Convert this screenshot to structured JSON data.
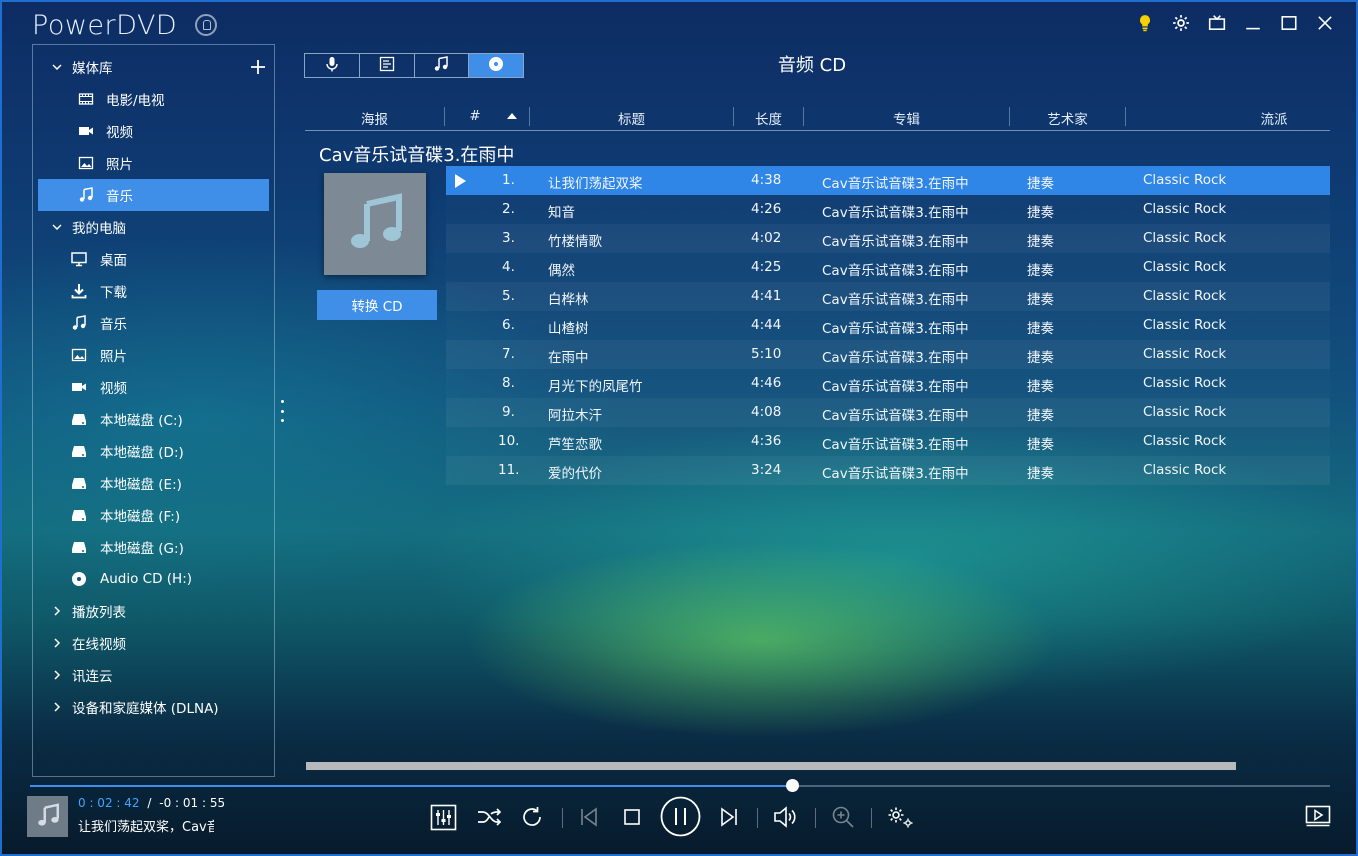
{
  "app": {
    "title": "PowerDVD"
  },
  "sidebar": {
    "media_library": {
      "label": "媒体库",
      "items": [
        {
          "label": "电影/电视",
          "icon": "film-icon"
        },
        {
          "label": "视频",
          "icon": "video-camera-icon"
        },
        {
          "label": "照片",
          "icon": "photo-icon"
        },
        {
          "label": "音乐",
          "icon": "music-note-icon",
          "active": true
        }
      ]
    },
    "my_computer": {
      "label": "我的电脑",
      "items": [
        {
          "label": "桌面",
          "icon": "monitor-icon"
        },
        {
          "label": "下载",
          "icon": "download-icon"
        },
        {
          "label": "音乐",
          "icon": "music-note-icon"
        },
        {
          "label": "照片",
          "icon": "photo-icon"
        },
        {
          "label": "视频",
          "icon": "video-camera-icon"
        },
        {
          "label": "本地磁盘 (C:)",
          "icon": "drive-icon"
        },
        {
          "label": "本地磁盘 (D:)",
          "icon": "drive-icon"
        },
        {
          "label": "本地磁盘 (E:)",
          "icon": "drive-icon"
        },
        {
          "label": "本地磁盘 (F:)",
          "icon": "drive-icon"
        },
        {
          "label": "本地磁盘 (G:)",
          "icon": "drive-icon"
        },
        {
          "label": "Audio CD (H:)",
          "icon": "disc-icon"
        }
      ]
    },
    "collapsed_sections": [
      {
        "label": "播放列表"
      },
      {
        "label": "在线视频"
      },
      {
        "label": "讯连云"
      },
      {
        "label": "设备和家庭媒体 (DLNA)"
      }
    ]
  },
  "tabs": [
    {
      "icon": "microphone-icon"
    },
    {
      "icon": "lyrics-sheet-icon"
    },
    {
      "icon": "music-note-icon"
    },
    {
      "icon": "cd-disc-icon",
      "active": true
    }
  ],
  "page_title": "音频 CD",
  "table": {
    "columns": {
      "poster": "海报",
      "number": "#",
      "title": "标题",
      "length": "长度",
      "album": "专辑",
      "artist": "艺术家",
      "genre": "流派"
    },
    "sort_column": "number",
    "sort_direction": "ascending"
  },
  "album": {
    "title": "Cav音乐试音碟3.在雨中",
    "convert_button": "转换 CD"
  },
  "tracks": [
    {
      "num": "1.",
      "title": "让我们荡起双桨",
      "length": "4:38",
      "album": "Cav音乐试音碟3.在雨中",
      "artist": "捷奏",
      "genre": "Classic Rock",
      "playing": true
    },
    {
      "num": "2.",
      "title": "知音",
      "length": "4:26",
      "album": "Cav音乐试音碟3.在雨中",
      "artist": "捷奏",
      "genre": "Classic Rock"
    },
    {
      "num": "3.",
      "title": "竹楼情歌",
      "length": "4:02",
      "album": "Cav音乐试音碟3.在雨中",
      "artist": "捷奏",
      "genre": "Classic Rock"
    },
    {
      "num": "4.",
      "title": "偶然",
      "length": "4:25",
      "album": "Cav音乐试音碟3.在雨中",
      "artist": "捷奏",
      "genre": "Classic Rock"
    },
    {
      "num": "5.",
      "title": "白桦林",
      "length": "4:41",
      "album": "Cav音乐试音碟3.在雨中",
      "artist": "捷奏",
      "genre": "Classic Rock"
    },
    {
      "num": "6.",
      "title": "山楂树",
      "length": "4:44",
      "album": "Cav音乐试音碟3.在雨中",
      "artist": "捷奏",
      "genre": "Classic Rock"
    },
    {
      "num": "7.",
      "title": "在雨中",
      "length": "5:10",
      "album": "Cav音乐试音碟3.在雨中",
      "artist": "捷奏",
      "genre": "Classic Rock"
    },
    {
      "num": "8.",
      "title": "月光下的凤尾竹",
      "length": "4:46",
      "album": "Cav音乐试音碟3.在雨中",
      "artist": "捷奏",
      "genre": "Classic Rock"
    },
    {
      "num": "9.",
      "title": "阿拉木汗",
      "length": "4:08",
      "album": "Cav音乐试音碟3.在雨中",
      "artist": "捷奏",
      "genre": "Classic Rock"
    },
    {
      "num": "10.",
      "title": "芦笙恋歌",
      "length": "4:36",
      "album": "Cav音乐试音碟3.在雨中",
      "artist": "捷奏",
      "genre": "Classic Rock"
    },
    {
      "num": "11.",
      "title": "爱的代价",
      "length": "3:24",
      "album": "Cav音乐试音碟3.在雨中",
      "artist": "捷奏",
      "genre": "Classic Rock"
    }
  ],
  "player": {
    "elapsed": "0 : 02 : 42",
    "separator": "/",
    "remaining": "-0 : 01 : 55",
    "now_playing": "让我们荡起双桨，Cav音",
    "progress": 0.586
  },
  "colors": {
    "accent": "#3f8fe8",
    "elapsed_time": "#3fa5ff",
    "selected_row": "#2f86e6",
    "bulb": "#f5d200"
  }
}
